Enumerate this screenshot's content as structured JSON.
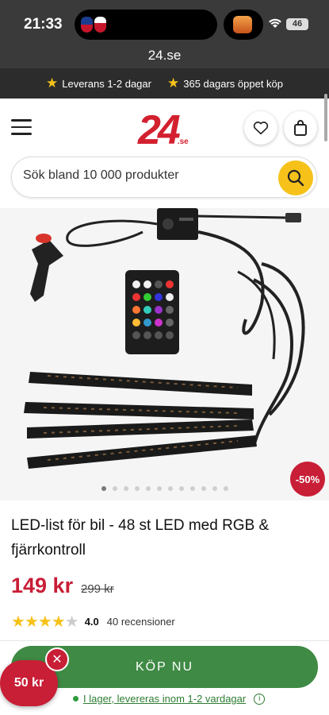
{
  "status_bar": {
    "time": "21:33",
    "battery": "46"
  },
  "browser": {
    "url": "24.se"
  },
  "promo_bar": {
    "item1": "Leverans 1-2 dagar",
    "item2": "365 dagars öppet köp"
  },
  "header": {
    "logo_text": "24",
    "logo_suffix": ".se"
  },
  "search": {
    "placeholder": "Sök bland 10 000 produkter"
  },
  "product": {
    "title": "LED-list för bil - 48 st LED med RGB & fjärrkontroll",
    "price": "149 kr",
    "old_price": "299 kr",
    "discount_badge": "-50%",
    "rating_value": 4.0,
    "rating_text": "4.0",
    "review_count": "40 recensioner",
    "image_count": 12,
    "active_image": 1
  },
  "actions": {
    "buy_label": "KÖP NU"
  },
  "stock": {
    "text": "I lager, levereras inom 1-2 vardagar"
  },
  "floating_promo": {
    "label": "50 kr"
  },
  "colors": {
    "brand_red": "#c81e36",
    "buy_green": "#3f8a44",
    "star_yellow": "#f6c21a"
  }
}
